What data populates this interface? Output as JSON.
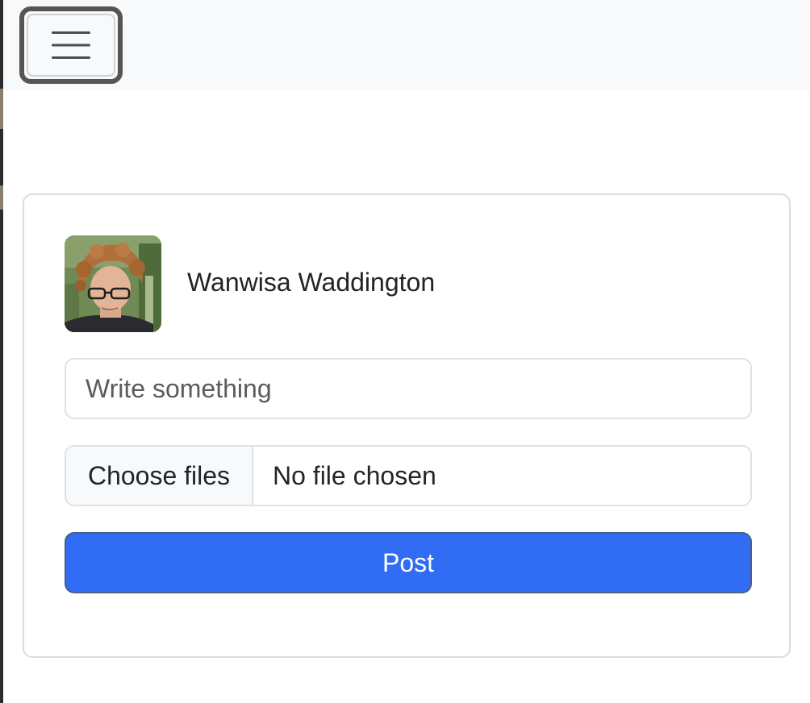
{
  "navbar": {
    "toggler_icon": "hamburger-menu-icon"
  },
  "post_form": {
    "author_name": "Wanwisa Waddington",
    "avatar_icon": "user-photo",
    "text_placeholder": "Write something",
    "text_value": "",
    "file_button_label": "Choose files",
    "file_status": "No file chosen",
    "submit_label": "Post"
  },
  "colors": {
    "primary": "#316cf4",
    "navbar_bg": "#f8f9fa",
    "border": "#dee2e6"
  }
}
